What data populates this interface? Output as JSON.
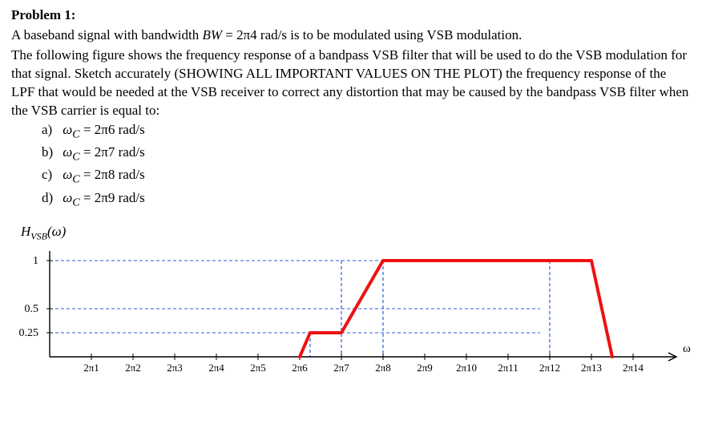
{
  "heading": "Problem 1:",
  "para1_a": "A baseband signal with bandwidth ",
  "bw_sym": "BW",
  "bw_eq": " = 2π4   rad/s is to be modulated using VSB modulation.",
  "para2": "The following figure shows the frequency response of a bandpass VSB filter that will be used to do the VSB modulation for that signal. Sketch accurately (SHOWING ALL IMPORTANT VALUES ON THE PLOT) the frequency response of the LPF that would be needed at the VSB receiver to correct any distortion that may be caused by the bandpass VSB filter when the VSB carrier is equal to:",
  "items": {
    "a": {
      "letter": "a)",
      "sym": "ω",
      "sub": "C",
      "eq": " = 2π6   rad/s"
    },
    "b": {
      "letter": "b)",
      "sym": "ω",
      "sub": "C",
      "eq": " = 2π7   rad/s"
    },
    "c": {
      "letter": "c)",
      "sym": "ω",
      "sub": "C",
      "eq": " = 2π8   rad/s"
    },
    "d": {
      "letter": "d)",
      "sym": "ω",
      "sub": "C",
      "eq": " = 2π9   rad/s"
    }
  },
  "fig": {
    "label_H": "H",
    "label_sub": "VSB",
    "label_arg": "(ω)",
    "y_ticks": [
      "1",
      "0.5",
      "0.25"
    ],
    "x_ticks": [
      "2π1",
      "2π2",
      "2π3",
      "2π4",
      "2π5",
      "2π6",
      "2π7",
      "2π8",
      "2π9",
      "2π10",
      "2π11",
      "2π12",
      "2π13",
      "2π14"
    ],
    "omega_sym": "ω"
  },
  "chart_data": {
    "type": "line",
    "title": "HVSB(ω)",
    "xlabel": "ω",
    "ylabel": "",
    "x_unit": "2π rad/s",
    "xlim": [
      0,
      15
    ],
    "ylim": [
      0,
      1
    ],
    "x_ticks": [
      1,
      2,
      3,
      4,
      5,
      6,
      7,
      8,
      9,
      10,
      11,
      12,
      13,
      14
    ],
    "y_ticks": [
      0.25,
      0.5,
      1
    ],
    "series": [
      {
        "name": "HVSB",
        "points": [
          {
            "x": 6,
            "y": 0
          },
          {
            "x": 6.25,
            "y": 0.25
          },
          {
            "x": 7,
            "y": 0.25
          },
          {
            "x": 8,
            "y": 1
          },
          {
            "x": 13,
            "y": 1
          },
          {
            "x": 13.5,
            "y": 0
          }
        ]
      }
    ],
    "guides_vertical_x": [
      6.25,
      7,
      8,
      12
    ],
    "guides_horizontal_y": [
      0.25,
      0.5,
      1
    ]
  }
}
